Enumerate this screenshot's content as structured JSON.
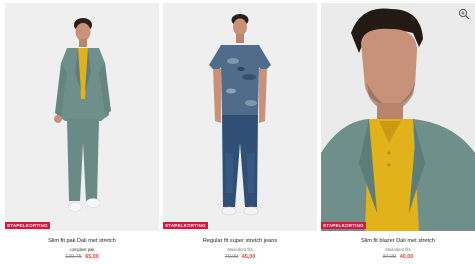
{
  "products": [
    {
      "badge": "STAPELKORTING",
      "title": "Slim fit pak Dali met stretch",
      "subtitle": "compleet pak",
      "old_price": "129,75",
      "new_price": "65,00"
    },
    {
      "badge": "STAPELKORTING",
      "title": "Regular fit super stretch jeans",
      "subtitle": "Maandera fits",
      "old_price": "79,99",
      "new_price": "45,00"
    },
    {
      "badge": "STAPELKORTING",
      "title": "Slim fit blazer Dali met stretch",
      "subtitle": "Maandera fits",
      "old_price": "84,99",
      "new_price": "40,00"
    }
  ],
  "icons": {
    "zoom": "zoom-in-icon"
  },
  "colors": {
    "badge": "#d6163c",
    "sale_price": "#e0452b",
    "suit": "#6f8f8b",
    "shirt_yellow": "#e2b21b",
    "tshirt_camo": "#4f6d8a",
    "jeans": "#2f4f76"
  }
}
